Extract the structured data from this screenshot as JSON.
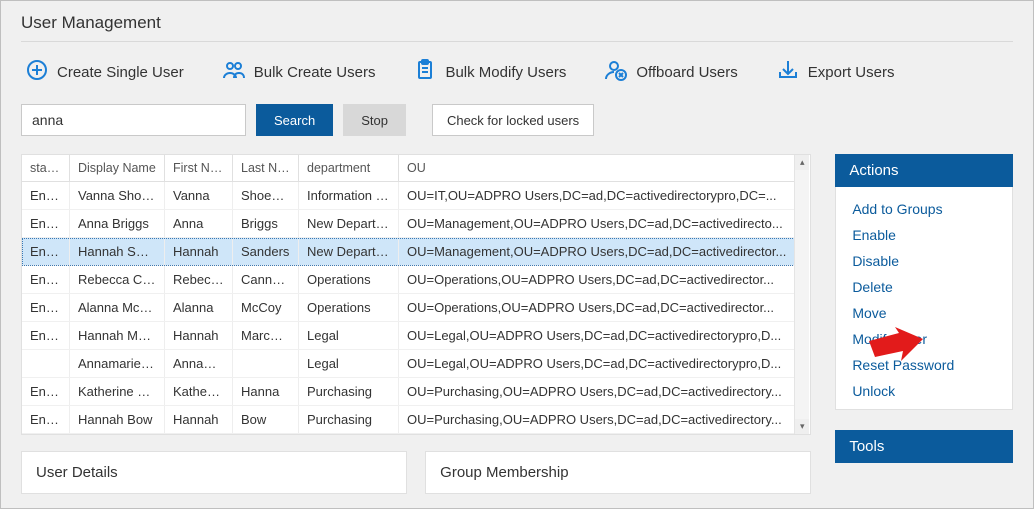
{
  "title": "User Management",
  "toolbar": [
    {
      "label": "Create Single User",
      "icon": "plus-circle"
    },
    {
      "label": "Bulk Create Users",
      "icon": "users"
    },
    {
      "label": "Bulk Modify Users",
      "icon": "clipboard"
    },
    {
      "label": "Offboard Users",
      "icon": "user-x"
    },
    {
      "label": "Export Users",
      "icon": "download"
    }
  ],
  "search": {
    "value": "anna",
    "search_btn": "Search",
    "stop_btn": "Stop",
    "check_locked_btn": "Check for locked users"
  },
  "grid": {
    "columns": [
      "status",
      "Display Name",
      "First Name",
      "Last Name",
      "department",
      "OU"
    ],
    "selected_index": 2,
    "rows": [
      {
        "status": "Ena...",
        "dn": "Vanna Shoem...",
        "fn": "Vanna",
        "ln": "Shoema...",
        "dept": "Information Sy...",
        "ou": "OU=IT,OU=ADPRO Users,DC=ad,DC=activedirectorypro,DC=..."
      },
      {
        "status": "Ena...",
        "dn": "Anna Briggs",
        "fn": "Anna",
        "ln": "Briggs",
        "dept": "New Department",
        "ou": "OU=Management,OU=ADPRO Users,DC=ad,DC=activedirecto..."
      },
      {
        "status": "Ena...",
        "dn": "Hannah Sand...",
        "fn": "Hannah",
        "ln": "Sanders",
        "dept": "New Department",
        "ou": "OU=Management,OU=ADPRO Users,DC=ad,DC=activedirector..."
      },
      {
        "status": "Ena...",
        "dn": "Rebecca Can...",
        "fn": "Rebecca",
        "ln": "Cannad...",
        "dept": "Operations",
        "ou": "OU=Operations,OU=ADPRO Users,DC=ad,DC=activedirector..."
      },
      {
        "status": "Ena...",
        "dn": "Alanna McCoy",
        "fn": "Alanna",
        "ln": "McCoy",
        "dept": "Operations",
        "ou": "OU=Operations,OU=ADPRO Users,DC=ad,DC=activedirector..."
      },
      {
        "status": "Ena...",
        "dn": "Hannah Marc...",
        "fn": "Hannah",
        "ln": "Marcano",
        "dept": "Legal",
        "ou": "OU=Legal,OU=ADPRO Users,DC=ad,DC=activedirectorypro,D..."
      },
      {
        "status": "",
        "dn": "Annamarie S...",
        "fn": "Annama...",
        "ln": "",
        "dept": "Legal",
        "ou": "OU=Legal,OU=ADPRO Users,DC=ad,DC=activedirectorypro,D..."
      },
      {
        "status": "Ena...",
        "dn": "Katherine Ha...",
        "fn": "Katherine",
        "ln": "Hanna",
        "dept": "Purchasing",
        "ou": "OU=Purchasing,OU=ADPRO Users,DC=ad,DC=activedirectory..."
      },
      {
        "status": "Ena...",
        "dn": "Hannah Bow",
        "fn": "Hannah",
        "ln": "Bow",
        "dept": "Purchasing",
        "ou": "OU=Purchasing,OU=ADPRO Users,DC=ad,DC=activedirectory..."
      }
    ]
  },
  "actions_panel": {
    "title": "Actions",
    "items": [
      "Add to Groups",
      "Enable",
      "Disable",
      "Delete",
      "Move",
      "Modify User",
      "Reset Password",
      "Unlock"
    ]
  },
  "tools_panel": {
    "title": "Tools"
  },
  "details": {
    "user_details_title": "User Details",
    "group_membership_title": "Group Membership"
  },
  "colors": {
    "primary": "#0b5b9c"
  }
}
